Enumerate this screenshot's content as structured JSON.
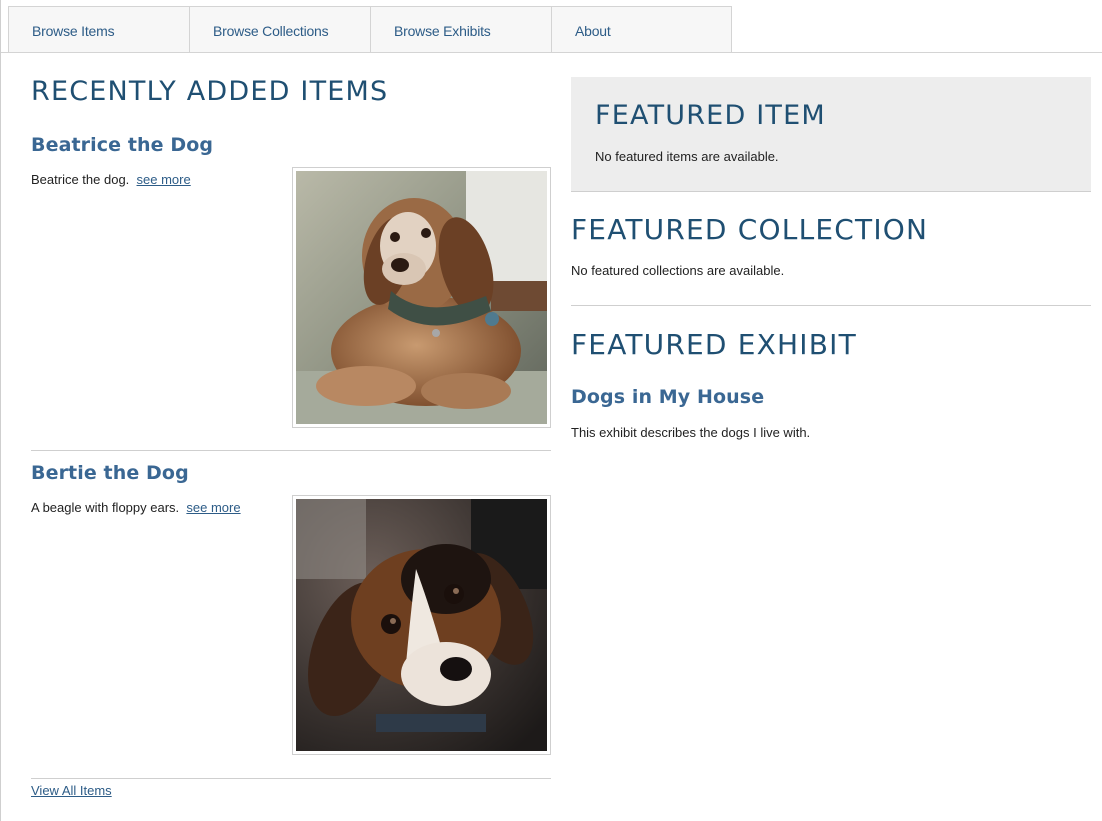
{
  "nav": {
    "items": [
      {
        "label": "Browse Items"
      },
      {
        "label": "Browse Collections"
      },
      {
        "label": "Browse Exhibits"
      },
      {
        "label": "About"
      }
    ]
  },
  "recent": {
    "heading": "Recently Added Items",
    "items": [
      {
        "title": "Beatrice the Dog",
        "description": "Beatrice the dog.",
        "more_link": "see more",
        "image": "dog-photo-beatrice"
      },
      {
        "title": "Bertie the Dog",
        "description": "A beagle with floppy ears.",
        "more_link": "see more",
        "image": "dog-photo-bertie"
      }
    ],
    "view_all": "View All Items"
  },
  "featured_item": {
    "heading": "Featured Item",
    "text": "No featured items are available."
  },
  "featured_collection": {
    "heading": "Featured Collection",
    "text": "No featured collections are available."
  },
  "featured_exhibit": {
    "heading": "Featured Exhibit",
    "title": "Dogs in My House",
    "text": "This exhibit describes the dogs I live with."
  }
}
